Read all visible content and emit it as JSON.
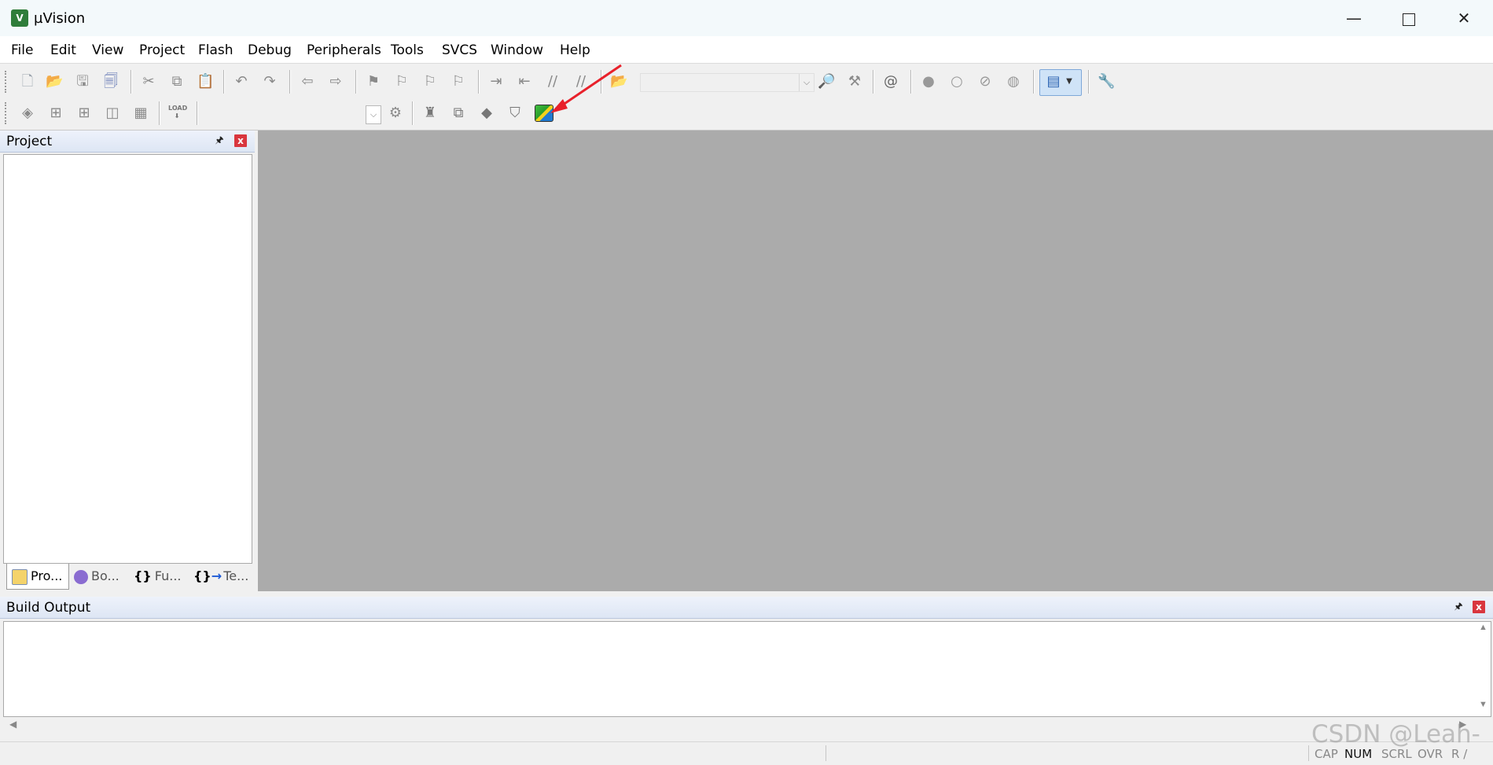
{
  "window": {
    "app_icon_letter": "V",
    "title": "µVision",
    "minimize_glyph": "—",
    "close_glyph": "✕"
  },
  "menu": {
    "items": [
      "File",
      "Edit",
      "View",
      "Project",
      "Flash",
      "Debug",
      "Peripherals",
      "Tools",
      "SVCS",
      "Window",
      "Help"
    ]
  },
  "toolbar": {
    "load_label": "LOAD",
    "target_combo_value": "",
    "config_combo_value": ""
  },
  "project_panel": {
    "title": "Project",
    "pin_glyph": "🖈",
    "close_glyph": "x",
    "tabs": [
      {
        "label": "Pro...",
        "icon": "project-icon",
        "active": true
      },
      {
        "label": "Bo...",
        "icon": "books-icon",
        "active": false
      },
      {
        "label": "Fu...",
        "icon": "functions-icon",
        "active": false
      },
      {
        "label": "Te...",
        "icon": "templates-icon",
        "active": false
      }
    ]
  },
  "build_output": {
    "title": "Build Output",
    "pin_glyph": "🖈",
    "close_glyph": "x"
  },
  "statusbar": {
    "indicators": [
      {
        "label": "CAP",
        "active": false
      },
      {
        "label": "NUM",
        "active": true
      },
      {
        "label": "SCRL",
        "active": false
      },
      {
        "label": "OVR",
        "active": false
      },
      {
        "label": "R /",
        "active": false
      }
    ]
  },
  "watermark": "CSDN @Leah-",
  "colors": {
    "editor_background": "#ababab",
    "annotation_arrow": "#e8212b",
    "close_button": "#d9363e",
    "highlighted_button": "#cfe3f7"
  }
}
